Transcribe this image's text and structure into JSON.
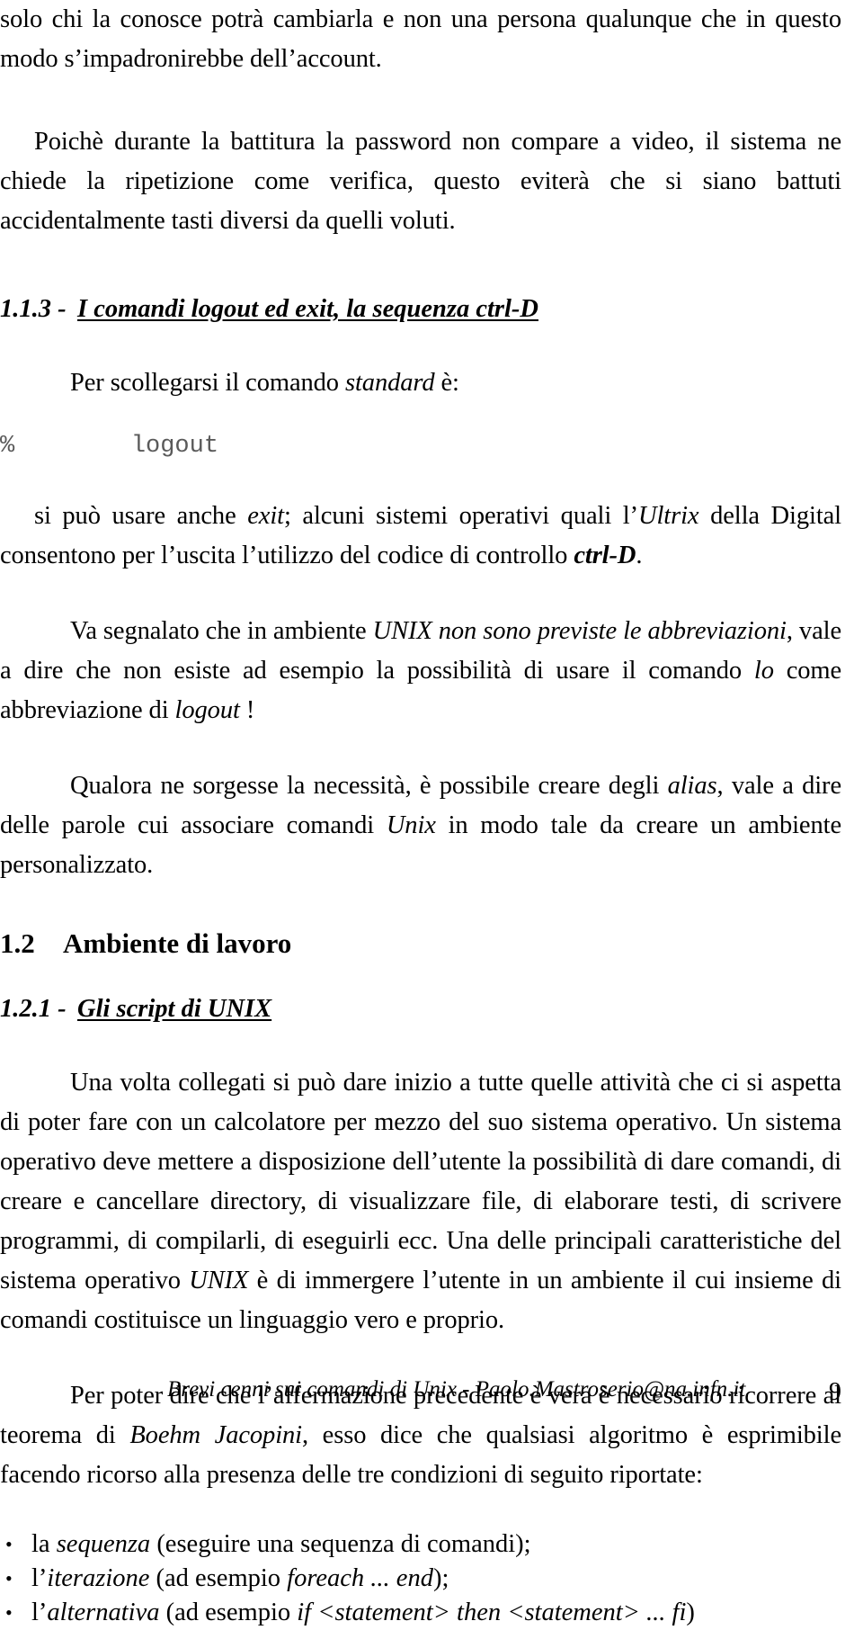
{
  "document": {
    "language": "it",
    "page_number": "9",
    "footer_text": "Brevi cenni sui comandi di Unix - Paolo.Mastroserio@na.infn.it"
  },
  "body": {
    "para_continued": {
      "part1": "solo chi la conosce potrà cambiarla e non una persona qualunque che in questo modo s",
      "apostrophe": "’",
      "part2": "impadronirebbe dell",
      "apostrophe2": "’",
      "part3": "account."
    },
    "para_poiche": "Poichè durante la battitura la password non compare a video, il sistema ne chiede la ripetizione come verifica, questo eviterà che si siano battuti accidentalmente tasti diversi da quelli voluti.",
    "heading_113": {
      "number": "1.1.3 -",
      "title": "I comandi logout ed exit, la sequenza ctrl-D"
    },
    "para_per_scollegarsi": {
      "part1": "Per scollegarsi il comando ",
      "em": "standard",
      "part2": " è:"
    },
    "code_line": {
      "prompt": "%",
      "command": "logout",
      "full": "%        logout"
    },
    "para_exit": {
      "part1": "si può usare anche ",
      "em1": "exit",
      "part2": "; alcuni sistemi operativi quali l’",
      "em2": "Ultrix",
      "part3": " della Digital consentono per l’uscita l’utilizzo del codice di controllo ",
      "em3": "ctrl-D",
      "part4": "."
    },
    "para_va_segnalato": {
      "part1": "Va segnalato che in ambiente ",
      "em1": "UNIX non sono previste le abbreviazioni",
      "part2": ", vale a dire che non esiste ad esempio la possibilità di usare il comando ",
      "em2": "lo",
      "part3": " come abbreviazione di ",
      "em3": "logout",
      "part4": " !"
    },
    "para_alias": {
      "part1": "Qualora ne sorgesse la necessità, è possibile creare degli ",
      "em1": "alias",
      "part2": ", vale a dire delle parole cui associare comandi ",
      "em2": "Unix",
      "part3": " in modo tale da creare un ambiente personalizzato."
    },
    "heading_12": {
      "number": "1.2",
      "title": "Ambiente di lavoro"
    },
    "heading_121": {
      "number": "1.2.1 -",
      "title": "Gli script di UNIX"
    },
    "para_una_volta": {
      "part1": "Una volta collegati si può dare inizio a tutte quelle attività che ci si aspetta di poter fare con un calcolatore per mezzo del suo sistema operativo. Un sistema operativo deve mettere a disposizione dell’utente la possibilità di dare comandi, di creare e cancellare directory, di visualizzare file, di elaborare testi, di scrivere programmi, di compilarli, di eseguirli ecc. Una delle principali caratteristiche del sistema operativo ",
      "em1": "UNIX",
      "part2": " è di immergere l’utente in un ambiente il cui insieme di comandi costituisce un linguaggio vero e proprio."
    },
    "para_boehm": {
      "part1": "Per poter dire che l’affermazione precedente è vera è necessario ricorrere al teorema di ",
      "em1": "Boehm Jacopini",
      "part2": ", esso dice che qualsiasi algoritmo è esprimibile facendo ricorso alla presenza delle tre condizioni di seguito riportate:"
    },
    "bullets": [
      {
        "marker": "•",
        "part1": "la ",
        "em1": "sequenza",
        "part2": " (eseguire una sequenza di comandi);",
        "em2": "",
        "part3": "",
        "em3": "",
        "part4": ""
      },
      {
        "marker": "•",
        "part1": "l’",
        "em1": "iterazione",
        "part2": " (ad esempio ",
        "em2": "foreach ... end",
        "part3": ");",
        "em3": "",
        "part4": ""
      },
      {
        "marker": "•",
        "part1": "l’",
        "em1": "alternativa",
        "part2": " (ad esempio ",
        "em2": "if <statement> then <statement> ... fi",
        "part3": ")",
        "em3": "",
        "part4": ""
      }
    ]
  }
}
